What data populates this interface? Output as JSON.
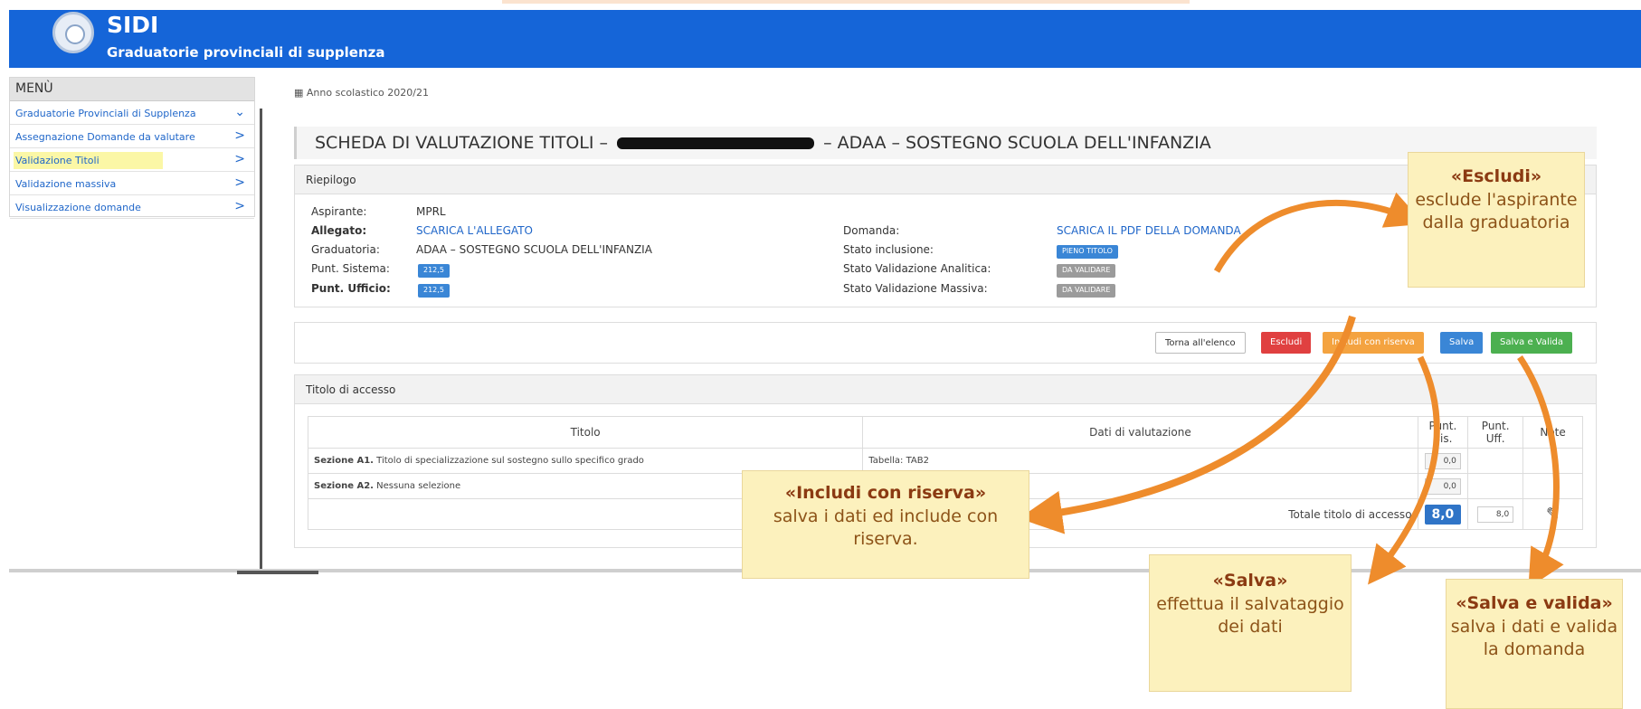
{
  "header": {
    "app_name": "SIDI",
    "subtitle": "Graduatorie provinciali di supplenza"
  },
  "sidebar": {
    "title": "MENÙ",
    "items": [
      {
        "label": "Graduatorie Provinciali di Supplenza",
        "icon": "chevron-down-icon"
      },
      {
        "label": "Assegnazione Domande da valutare",
        "icon": "chevron-right-icon"
      },
      {
        "label": "Validazione Titoli",
        "icon": "chevron-right-icon"
      },
      {
        "label": "Validazione massiva",
        "icon": "chevron-right-icon"
      },
      {
        "label": "Visualizzazione domande",
        "icon": "chevron-right-icon"
      }
    ]
  },
  "school_year": "Anno scolastico 2020/21",
  "page_title": {
    "prefix": "SCHEDA DI VALUTAZIONE TITOLI –",
    "suffix": "– ADAA – SOSTEGNO SCUOLA DELL'INFANZIA"
  },
  "riepilogo": {
    "heading": "Riepilogo",
    "aspirante_label": "Aspirante:",
    "aspirante_value": "MPRL",
    "allegato_label": "Allegato:",
    "allegato_value": "SCARICA L'ALLEGATO",
    "graduatoria_label": "Graduatoria:",
    "graduatoria_value": "ADAA – SOSTEGNO SCUOLA DELL'INFANZIA",
    "punt_sistema_label": "Punt. Sistema:",
    "punt_sistema_value": "212,5",
    "punt_ufficio_label": "Punt. Ufficio:",
    "punt_ufficio_value": "212,5",
    "domanda_label": "Domanda:",
    "domanda_value": "SCARICA IL PDF DELLA DOMANDA",
    "stato_inclusione_label": "Stato inclusione:",
    "stato_inclusione_value": "PIENO TITOLO",
    "stato_analitica_label": "Stato Validazione Analitica:",
    "stato_analitica_value": "DA VALIDARE",
    "stato_massiva_label": "Stato Validazione Massiva:",
    "stato_massiva_value": "DA VALIDARE"
  },
  "actions": {
    "back": "Torna all'elenco",
    "exclude": "Escludi",
    "include_reserve": "Includi con riserva",
    "save": "Salva",
    "save_validate": "Salva e Valida"
  },
  "titolo_accesso": {
    "heading": "Titolo di accesso",
    "columns": [
      "Titolo",
      "Dati di valutazione",
      "Punt. Sis.",
      "Punt. Uff.",
      "Note"
    ],
    "rows": [
      {
        "titolo_bold": "Sezione A1.",
        "titolo": "Titolo di specializzazione sul sostegno sullo specifico grado",
        "dati": "Tabella: TAB2",
        "punt_sis": "0,0"
      },
      {
        "titolo_bold": "Sezione A2.",
        "titolo": "Nessuna selezione",
        "dati": "",
        "punt_sis": "0,0"
      }
    ],
    "totale_label": "Totale titolo di accesso",
    "totale_sis": "8,0",
    "totale_uff": "8,0"
  },
  "callouts": {
    "escludi": {
      "title": "«Escludi»",
      "text": "esclude l'aspirante dalla graduatoria"
    },
    "includi": {
      "title": "«Includi con riserva»",
      "text": "salva i dati ed include con riserva."
    },
    "salva": {
      "title": "«Salva»",
      "text": "effettua il salvataggio dei dati"
    },
    "salva_valida": {
      "title": "«Salva e valida»",
      "text": "salva i dati e valida la domanda"
    }
  },
  "colors": {
    "header_blue": "#1565d8",
    "danger": "#e04040",
    "warning": "#f4a340",
    "primary": "#3a86d6",
    "success": "#4cb050",
    "arrow": "#ee8c2c",
    "callout_bg": "#fcf1bd"
  }
}
